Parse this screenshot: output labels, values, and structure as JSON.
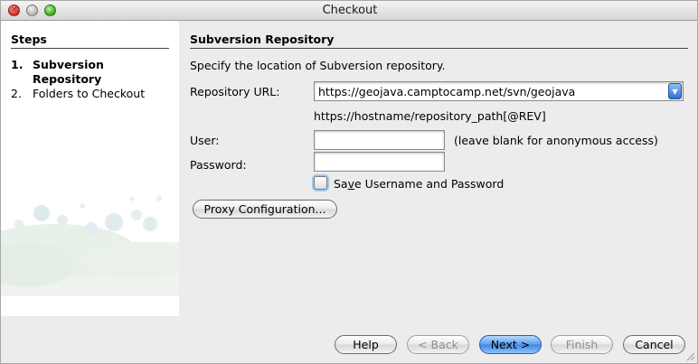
{
  "window": {
    "title": "Checkout",
    "close_glyph": "×"
  },
  "steps": {
    "heading": "Steps",
    "items": [
      {
        "number": "1.",
        "label": "Subversion Repository",
        "current": true
      },
      {
        "number": "2.",
        "label": "Folders to Checkout",
        "current": false
      }
    ]
  },
  "main": {
    "heading": "Subversion Repository",
    "description": "Specify the location of Subversion repository.",
    "url_label": "Repository URL:",
    "url_value": "https://geojava.camptocamp.net/svn/geojava",
    "url_dropdown_glyph": "▼",
    "url_hint": "https://hostname/repository_path[@REV]",
    "user_label": "User:",
    "user_value": "",
    "user_hint": "(leave blank for anonymous access)",
    "password_label": "Password:",
    "password_value": "",
    "save_label_pre": "Sa",
    "save_label_mnemonic": "v",
    "save_label_post": "e Username and Password",
    "save_checked": false,
    "proxy_button": "Proxy Configuration..."
  },
  "buttons": {
    "help": "Help",
    "back": "< Back",
    "next": "Next >",
    "finish": "Finish",
    "cancel": "Cancel"
  },
  "colors": {
    "accent": "#3c86e6",
    "steps_background": "#ffffff",
    "window_background": "#ececec"
  },
  "icons": {
    "close": "close-icon",
    "minimize": "minimize-icon",
    "zoom": "zoom-icon",
    "dropdown": "chevron-down-icon",
    "decoration": "bubbles-decoration",
    "resize": "resize-grip-icon"
  }
}
